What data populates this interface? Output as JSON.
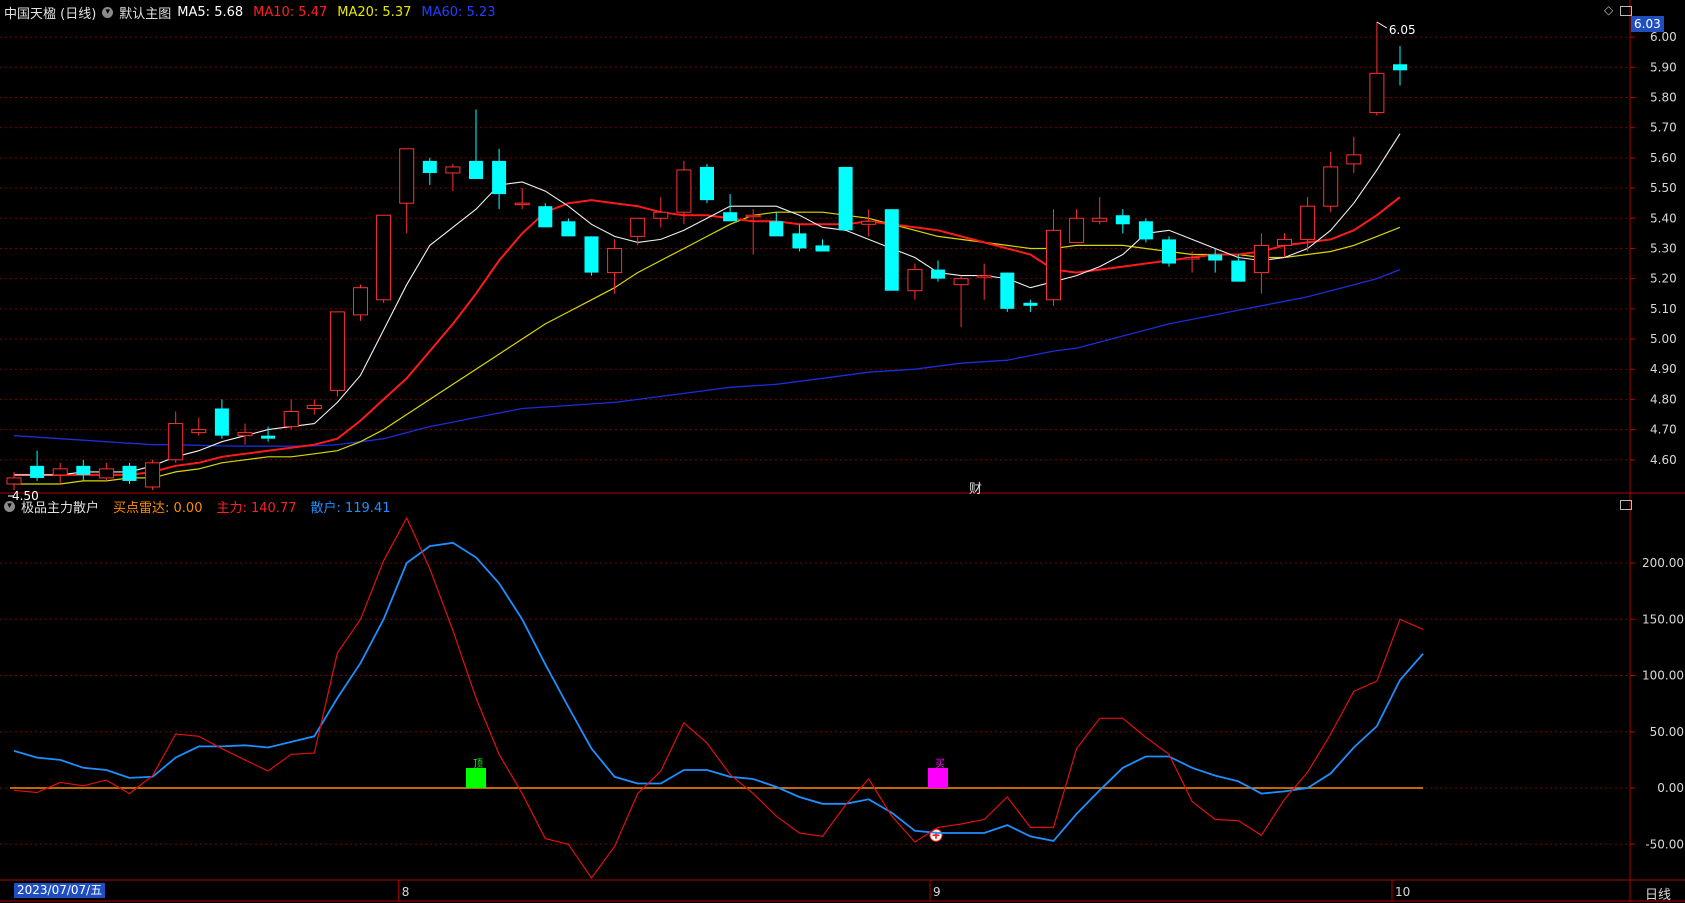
{
  "header": {
    "stock_title": "中国天楹 (日线)",
    "template_label": "默认主图",
    "ma": [
      {
        "label": "MA5: 5.68",
        "color": "#ffffff"
      },
      {
        "label": "MA10: 5.47",
        "color": "#ff2020"
      },
      {
        "label": "MA20: 5.37",
        "color": "#e8e800"
      },
      {
        "label": "MA60: 5.23",
        "color": "#2040ff"
      }
    ]
  },
  "indicator": {
    "name": "极品主力散户",
    "items": [
      {
        "label": "买点雷达: 0.00",
        "color": "#ff8c00"
      },
      {
        "label": "主力: 140.77",
        "color": "#ff2020"
      },
      {
        "label": "散户: 119.41",
        "color": "#1e8fff"
      }
    ]
  },
  "labels": {
    "high_price": "6.05",
    "low_price": "4.50",
    "current_price": "6.03",
    "cai_mark": "财",
    "top_marker": "顶",
    "buy_marker": "买",
    "start_date": "2023/07/07/五",
    "period": "日线",
    "month_ticks": [
      {
        "label": "8",
        "index": 17
      },
      {
        "label": "9",
        "index": 40
      },
      {
        "label": "10",
        "index": 60
      }
    ]
  },
  "colors": {
    "up": "#ff3030",
    "down": "#00ffff",
    "grid": "#7a0000",
    "axis_line": "#b00000",
    "zero_line": "#ff8c00",
    "top_marker": "#00ff00",
    "buy_marker": "#ff00ff"
  },
  "chart_data": [
    {
      "type": "candlestick",
      "ylim": [
        4.5,
        6.05
      ],
      "y_ticks": [
        4.6,
        4.7,
        4.8,
        4.9,
        5.0,
        5.1,
        5.2,
        5.3,
        5.4,
        5.5,
        5.6,
        5.7,
        5.8,
        5.9,
        6.0
      ],
      "ohlc": [
        [
          4.52,
          4.56,
          4.5,
          4.54
        ],
        [
          4.58,
          4.63,
          4.53,
          4.54
        ],
        [
          4.55,
          4.59,
          4.52,
          4.57
        ],
        [
          4.58,
          4.6,
          4.53,
          4.55
        ],
        [
          4.54,
          4.59,
          4.53,
          4.57
        ],
        [
          4.58,
          4.59,
          4.52,
          4.53
        ],
        [
          4.51,
          4.6,
          4.5,
          4.59
        ],
        [
          4.6,
          4.76,
          4.59,
          4.72
        ],
        [
          4.69,
          4.74,
          4.68,
          4.7
        ],
        [
          4.77,
          4.8,
          4.67,
          4.68
        ],
        [
          4.68,
          4.72,
          4.65,
          4.69
        ],
        [
          4.68,
          4.71,
          4.66,
          4.67
        ],
        [
          4.71,
          4.8,
          4.7,
          4.76
        ],
        [
          4.77,
          4.8,
          4.75,
          4.78
        ],
        [
          4.83,
          5.09,
          4.81,
          5.09
        ],
        [
          5.08,
          5.18,
          5.06,
          5.17
        ],
        [
          5.13,
          5.41,
          5.12,
          5.41
        ],
        [
          5.45,
          5.63,
          5.35,
          5.63
        ],
        [
          5.59,
          5.6,
          5.51,
          5.55
        ],
        [
          5.55,
          5.58,
          5.49,
          5.57
        ],
        [
          5.59,
          5.76,
          5.54,
          5.53
        ],
        [
          5.59,
          5.63,
          5.43,
          5.48
        ],
        [
          5.45,
          5.5,
          5.43,
          5.45
        ],
        [
          5.44,
          5.45,
          5.37,
          5.37
        ],
        [
          5.39,
          5.4,
          5.34,
          5.34
        ],
        [
          5.34,
          5.34,
          5.21,
          5.22
        ],
        [
          5.22,
          5.33,
          5.15,
          5.3
        ],
        [
          5.34,
          5.4,
          5.31,
          5.4
        ],
        [
          5.4,
          5.47,
          5.37,
          5.42
        ],
        [
          5.42,
          5.59,
          5.38,
          5.56
        ],
        [
          5.57,
          5.58,
          5.45,
          5.46
        ],
        [
          5.42,
          5.48,
          5.39,
          5.39
        ],
        [
          5.41,
          5.43,
          5.28,
          5.41
        ],
        [
          5.39,
          5.42,
          5.35,
          5.34
        ],
        [
          5.35,
          5.38,
          5.29,
          5.3
        ],
        [
          5.31,
          5.33,
          5.29,
          5.29
        ],
        [
          5.57,
          5.57,
          5.36,
          5.36
        ],
        [
          5.38,
          5.43,
          5.34,
          5.39
        ],
        [
          5.43,
          5.43,
          5.22,
          5.16
        ],
        [
          5.16,
          5.25,
          5.13,
          5.23
        ],
        [
          5.23,
          5.26,
          5.19,
          5.2
        ],
        [
          5.18,
          5.21,
          5.04,
          5.2
        ],
        [
          5.21,
          5.25,
          5.13,
          5.21
        ],
        [
          5.22,
          5.22,
          5.09,
          5.1
        ],
        [
          5.12,
          5.13,
          5.09,
          5.11
        ],
        [
          5.13,
          5.43,
          5.11,
          5.36
        ],
        [
          5.32,
          5.43,
          5.32,
          5.4
        ],
        [
          5.39,
          5.47,
          5.38,
          5.4
        ],
        [
          5.41,
          5.43,
          5.35,
          5.38
        ],
        [
          5.39,
          5.4,
          5.32,
          5.33
        ],
        [
          5.33,
          5.34,
          5.24,
          5.25
        ],
        [
          5.27,
          5.29,
          5.22,
          5.27
        ],
        [
          5.28,
          5.3,
          5.22,
          5.26
        ],
        [
          5.26,
          5.28,
          5.19,
          5.19
        ],
        [
          5.22,
          5.35,
          5.15,
          5.31
        ],
        [
          5.31,
          5.35,
          5.27,
          5.33
        ],
        [
          5.33,
          5.47,
          5.29,
          5.44
        ],
        [
          5.44,
          5.62,
          5.42,
          5.57
        ],
        [
          5.58,
          5.67,
          5.55,
          5.61
        ],
        [
          5.75,
          6.05,
          5.74,
          5.88
        ],
        [
          5.91,
          5.97,
          5.84,
          5.89
        ]
      ],
      "ma5": [
        4.55,
        4.55,
        4.55,
        4.56,
        4.56,
        4.56,
        4.58,
        4.61,
        4.63,
        4.66,
        4.68,
        4.7,
        4.71,
        4.72,
        4.79,
        4.88,
        5.03,
        5.18,
        5.31,
        5.37,
        5.43,
        5.51,
        5.52,
        5.49,
        5.44,
        5.38,
        5.34,
        5.32,
        5.33,
        5.36,
        5.4,
        5.44,
        5.44,
        5.44,
        5.41,
        5.37,
        5.36,
        5.33,
        5.3,
        5.27,
        5.22,
        5.21,
        5.21,
        5.2,
        5.17,
        5.19,
        5.21,
        5.24,
        5.28,
        5.35,
        5.36,
        5.33,
        5.3,
        5.27,
        5.26,
        5.27,
        5.3,
        5.36,
        5.45,
        5.56,
        5.68
      ],
      "ma10": [
        4.55,
        4.55,
        4.55,
        4.55,
        4.55,
        4.55,
        4.56,
        4.58,
        4.59,
        4.61,
        4.62,
        4.63,
        4.64,
        4.65,
        4.67,
        4.73,
        4.8,
        4.87,
        4.96,
        5.05,
        5.15,
        5.26,
        5.35,
        5.42,
        5.45,
        5.46,
        5.45,
        5.44,
        5.42,
        5.41,
        5.41,
        5.4,
        5.39,
        5.39,
        5.38,
        5.38,
        5.38,
        5.39,
        5.38,
        5.37,
        5.36,
        5.34,
        5.32,
        5.3,
        5.28,
        5.23,
        5.22,
        5.23,
        5.24,
        5.25,
        5.26,
        5.27,
        5.28,
        5.28,
        5.29,
        5.31,
        5.32,
        5.33,
        5.36,
        5.41,
        5.47
      ],
      "ma20": [
        4.52,
        4.52,
        4.52,
        4.53,
        4.53,
        4.54,
        4.54,
        4.56,
        4.57,
        4.59,
        4.6,
        4.61,
        4.61,
        4.62,
        4.63,
        4.66,
        4.7,
        4.75,
        4.8,
        4.85,
        4.9,
        4.95,
        5.0,
        5.05,
        5.09,
        5.13,
        5.17,
        5.22,
        5.26,
        5.3,
        5.34,
        5.38,
        5.41,
        5.42,
        5.42,
        5.42,
        5.41,
        5.4,
        5.38,
        5.36,
        5.34,
        5.33,
        5.32,
        5.31,
        5.3,
        5.3,
        5.31,
        5.31,
        5.31,
        5.3,
        5.29,
        5.28,
        5.28,
        5.28,
        5.27,
        5.27,
        5.28,
        5.29,
        5.31,
        5.34,
        5.37
      ],
      "ma60": [
        4.68,
        4.675,
        4.67,
        4.665,
        4.66,
        4.655,
        4.65,
        4.65,
        4.648,
        4.646,
        4.645,
        4.645,
        4.645,
        4.646,
        4.65,
        4.66,
        4.67,
        4.69,
        4.71,
        4.725,
        4.74,
        4.755,
        4.77,
        4.775,
        4.78,
        4.785,
        4.79,
        4.8,
        4.81,
        4.82,
        4.83,
        4.84,
        4.845,
        4.85,
        4.86,
        4.87,
        4.88,
        4.89,
        4.895,
        4.9,
        4.91,
        4.92,
        4.925,
        4.93,
        4.945,
        4.96,
        4.97,
        4.99,
        5.01,
        5.03,
        5.05,
        5.065,
        5.08,
        5.095,
        5.11,
        5.125,
        5.14,
        5.16,
        5.18,
        5.2,
        5.23
      ]
    },
    {
      "type": "line",
      "series": [
        {
          "name": "主力",
          "values": [
            -2,
            -4,
            5,
            2,
            7,
            -5,
            11,
            48,
            46,
            35,
            25,
            15,
            30,
            31,
            120,
            150,
            202,
            240,
            195,
            140,
            80,
            30,
            -5,
            -45,
            -50,
            -80,
            -52,
            -5,
            15,
            58,
            40,
            12,
            -5,
            -25,
            -40,
            -43,
            -15,
            8,
            -25,
            -48,
            -35,
            -32,
            -28,
            -8,
            -35,
            -35,
            35,
            62,
            62,
            45,
            30,
            -12,
            -28,
            -29,
            -42,
            -10,
            14,
            48,
            86,
            95,
            150,
            141
          ]
        },
        {
          "name": "散户",
          "values": [
            33,
            27,
            25,
            18,
            16,
            9,
            10,
            27,
            37,
            37,
            38,
            36,
            41,
            46,
            80,
            111,
            150,
            200,
            215,
            218,
            205,
            182,
            150,
            110,
            72,
            35,
            10,
            4,
            4,
            16,
            16,
            10,
            8,
            1,
            -8,
            -14,
            -14,
            -10,
            -22,
            -38,
            -40,
            -40,
            -40,
            -33,
            -43,
            -47,
            -23,
            -2,
            18,
            28,
            28,
            18,
            11,
            6,
            -5,
            -3,
            0,
            13,
            36,
            55,
            96,
            119.41
          ]
        },
        {
          "name": "买点雷达",
          "values": [
            0,
            0,
            0,
            0,
            0,
            0,
            0,
            0,
            0,
            0,
            0,
            0,
            0,
            0,
            0,
            0,
            0,
            0,
            0,
            0,
            0,
            0,
            0,
            0,
            0,
            0,
            0,
            0,
            0,
            0,
            0,
            0,
            0,
            0,
            0,
            0,
            0,
            0,
            0,
            0,
            0,
            0,
            0,
            0,
            0,
            0,
            0,
            0,
            0,
            0,
            0,
            0,
            0,
            0,
            0,
            0,
            0,
            0,
            0,
            0,
            0,
            0
          ]
        }
      ],
      "ylim": [
        -80,
        240
      ],
      "y_ticks": [
        -50,
        0,
        50,
        100,
        150,
        200
      ],
      "y_tick_labels": [
        "-50.00",
        "0.00",
        "50.00",
        "100.00",
        "150.00",
        "200.00"
      ],
      "markers": [
        {
          "label": "顶",
          "index": 20
        },
        {
          "label": "买",
          "index": 40
        },
        {
          "label": "plus",
          "index": 40,
          "value": -42
        }
      ]
    }
  ]
}
